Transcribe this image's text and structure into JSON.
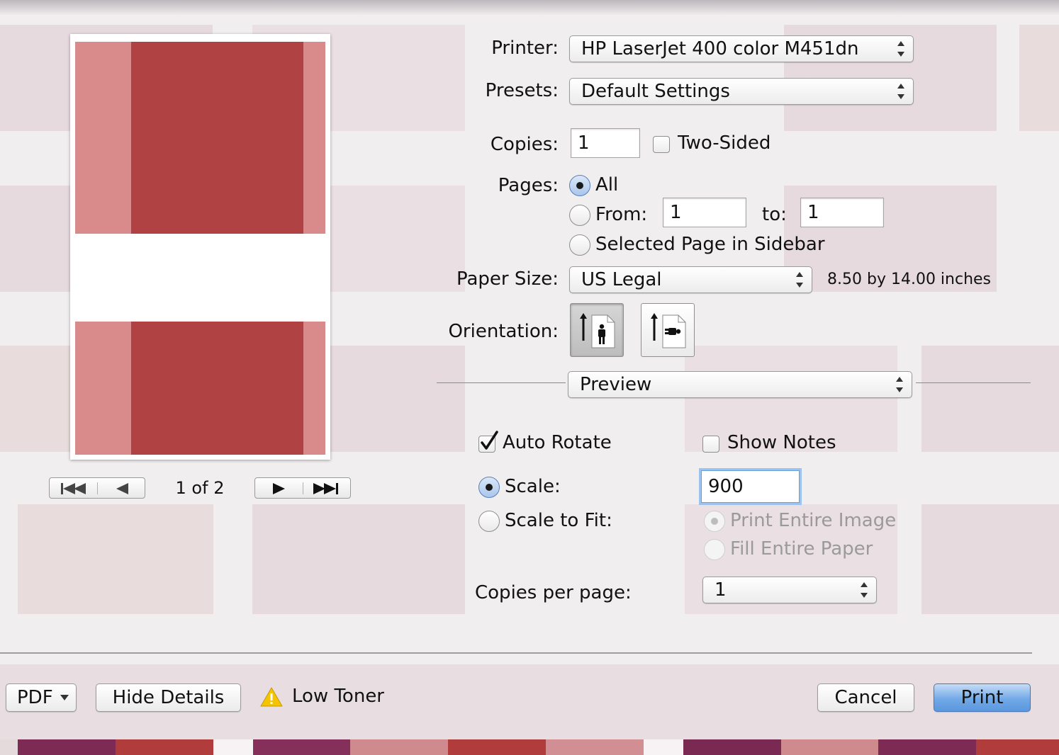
{
  "printer": {
    "label": "Printer:",
    "value": "HP LaserJet 400 color M451dn"
  },
  "presets": {
    "label": "Presets:",
    "value": "Default Settings"
  },
  "copies": {
    "label": "Copies:",
    "value": "1",
    "two_sided_label": "Two-Sided",
    "two_sided_checked": false
  },
  "pages": {
    "label": "Pages:",
    "all_label": "All",
    "from_label": "From:",
    "from_value": "1",
    "to_label": "to:",
    "to_value": "1",
    "selected_label": "Selected Page in Sidebar",
    "selected_option": "All"
  },
  "paper_size": {
    "label": "Paper Size:",
    "value": "US Legal",
    "dimensions": "8.50 by 14.00 inches"
  },
  "orientation": {
    "label": "Orientation:",
    "selected": "portrait"
  },
  "section_popup": {
    "value": "Preview"
  },
  "preview_options": {
    "auto_rotate_label": "Auto Rotate",
    "auto_rotate_checked": true,
    "show_notes_label": "Show Notes",
    "show_notes_checked": false,
    "scale_label": "Scale:",
    "scale_value": "900",
    "scale_to_fit_label": "Scale to Fit:",
    "print_entire_image_label": "Print Entire Image",
    "fill_entire_paper_label": "Fill Entire Paper",
    "copies_per_page_label": "Copies per page:",
    "copies_per_page_value": "1"
  },
  "page_nav": {
    "indicator": "1 of 2"
  },
  "footer": {
    "pdf_label": "PDF",
    "hide_details_label": "Hide Details",
    "warning_text": "Low Toner",
    "cancel_label": "Cancel",
    "print_label": "Print"
  },
  "colors": {
    "preview_dark": "#b04244",
    "preview_light": "#d98a8b",
    "primary_button": "#72a9e7",
    "warning": "#f5c400"
  }
}
